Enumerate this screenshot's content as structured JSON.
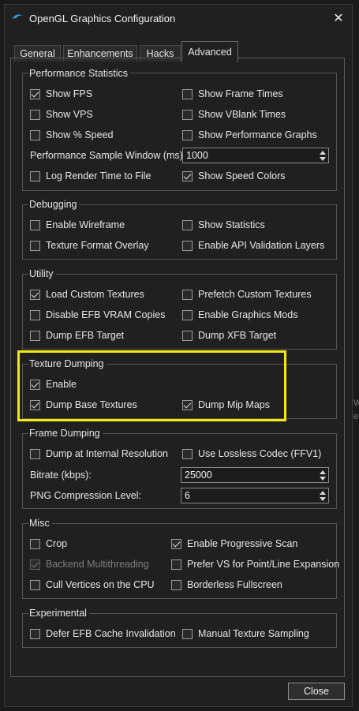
{
  "window": {
    "title": "OpenGL Graphics Configuration",
    "app_icon": "dolphin-icon",
    "close_icon": "close-icon",
    "close_glyph": "✕"
  },
  "tabs": [
    {
      "label": "General"
    },
    {
      "label": "Enhancements"
    },
    {
      "label": "Hacks"
    },
    {
      "label": "Advanced",
      "active": true
    }
  ],
  "groups": {
    "performance": {
      "title": "Performance Statistics",
      "show_fps": {
        "label": "Show FPS",
        "checked": true
      },
      "show_frame_times": {
        "label": "Show Frame Times",
        "checked": false
      },
      "show_vps": {
        "label": "Show VPS",
        "checked": false
      },
      "show_vblank_times": {
        "label": "Show VBlank Times",
        "checked": false
      },
      "show_speed": {
        "label": "Show % Speed",
        "checked": false
      },
      "show_perf_graphs": {
        "label": "Show Performance Graphs",
        "checked": false
      },
      "sample_window_label": "Performance Sample Window (ms):",
      "sample_window_value": "1000",
      "log_render_time": {
        "label": "Log Render Time to File",
        "checked": false
      },
      "show_speed_colors": {
        "label": "Show Speed Colors",
        "checked": true
      }
    },
    "debugging": {
      "title": "Debugging",
      "enable_wireframe": {
        "label": "Enable Wireframe",
        "checked": false
      },
      "show_statistics": {
        "label": "Show Statistics",
        "checked": false
      },
      "texture_format_overlay": {
        "label": "Texture Format Overlay",
        "checked": false
      },
      "api_validation": {
        "label": "Enable API Validation Layers",
        "checked": false
      }
    },
    "utility": {
      "title": "Utility",
      "load_custom_textures": {
        "label": "Load Custom Textures",
        "checked": true
      },
      "prefetch_custom_textures": {
        "label": "Prefetch Custom Textures",
        "checked": false
      },
      "disable_efb_vram": {
        "label": "Disable EFB VRAM Copies",
        "checked": false
      },
      "enable_graphics_mods": {
        "label": "Enable Graphics Mods",
        "checked": false
      },
      "dump_efb_target": {
        "label": "Dump EFB Target",
        "checked": false
      },
      "dump_xfb_target": {
        "label": "Dump XFB Target",
        "checked": false
      }
    },
    "texture_dumping": {
      "title": "Texture Dumping",
      "enable": {
        "label": "Enable",
        "checked": true
      },
      "dump_base_textures": {
        "label": "Dump Base Textures",
        "checked": true
      },
      "dump_mip_maps": {
        "label": "Dump Mip Maps",
        "checked": true
      }
    },
    "frame_dumping": {
      "title": "Frame Dumping",
      "dump_internal_res": {
        "label": "Dump at Internal Resolution",
        "checked": false
      },
      "lossless_codec": {
        "label": "Use Lossless Codec (FFV1)",
        "checked": false
      },
      "bitrate_label": "Bitrate (kbps):",
      "bitrate_value": "25000",
      "png_level_label": "PNG Compression Level:",
      "png_level_value": "6"
    },
    "misc": {
      "title": "Misc",
      "crop": {
        "label": "Crop",
        "checked": false
      },
      "progressive_scan": {
        "label": "Enable Progressive Scan",
        "checked": true
      },
      "backend_multithreading": {
        "label": "Backend Multithreading",
        "checked": true,
        "disabled": true
      },
      "prefer_vs": {
        "label": "Prefer VS for Point/Line Expansion",
        "checked": false
      },
      "cull_vertices": {
        "label": "Cull Vertices on the CPU",
        "checked": false
      },
      "borderless_fullscreen": {
        "label": "Borderless Fullscreen",
        "checked": false
      }
    },
    "experimental": {
      "title": "Experimental",
      "defer_efb": {
        "label": "Defer EFB Cache Invalidation",
        "checked": false
      },
      "manual_sampling": {
        "label": "Manual Texture Sampling",
        "checked": false
      }
    }
  },
  "buttons": {
    "close": "Close"
  },
  "background": {
    "right_edge_letter_1": "W",
    "right_edge_letter_2": "e"
  },
  "colors": {
    "highlight": "#f5e90f",
    "window_bg": "#202020"
  }
}
